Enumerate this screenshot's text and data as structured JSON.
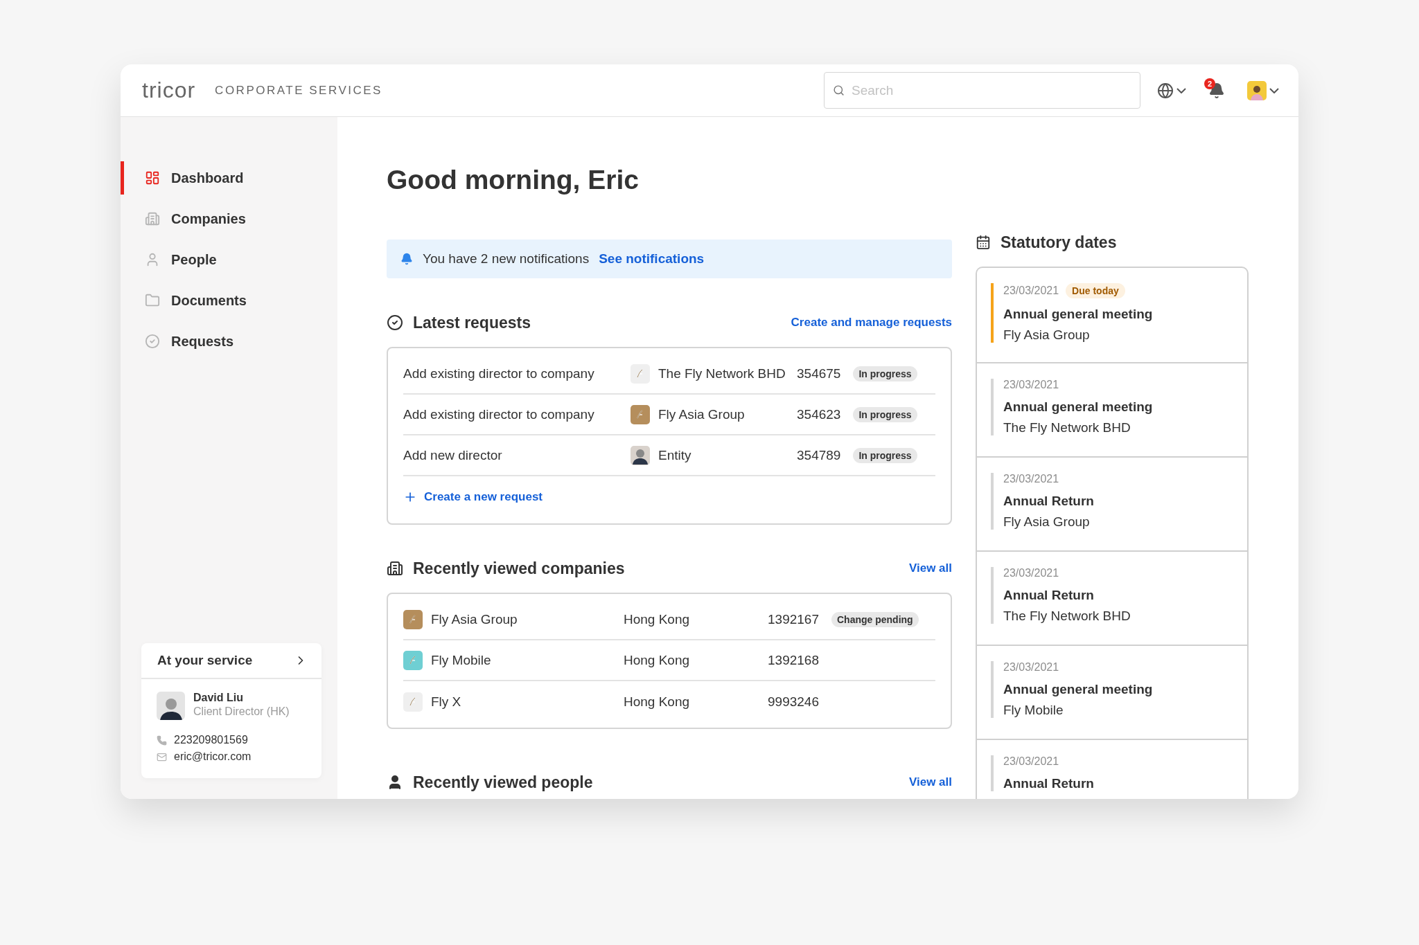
{
  "header": {
    "logo": "tricor",
    "product": "CORPORATE SERVICES",
    "search": {
      "placeholder": "Search"
    },
    "notification_count": "2"
  },
  "sidebar": {
    "items": [
      {
        "label": "Dashboard",
        "selected": true
      },
      {
        "label": "Companies",
        "selected": false
      },
      {
        "label": "People",
        "selected": false
      },
      {
        "label": "Documents",
        "selected": false
      },
      {
        "label": "Requests",
        "selected": false
      }
    ],
    "service_card": {
      "title": "At your service",
      "name": "David Liu",
      "role": "Client Director (HK)",
      "phone": "223209801569",
      "email": "eric@tricor.com"
    }
  },
  "greeting": "Good morning, Eric",
  "notice": {
    "text": "You have 2 new notifications",
    "link": "See notifications"
  },
  "latest_requests": {
    "title": "Latest requests",
    "link": "Create and manage requests",
    "rows": [
      {
        "request": "Add existing director to company",
        "entity": "The Fly Network BHD",
        "kind": "logo",
        "color": "#efefef",
        "number": "354675",
        "status": "In progress"
      },
      {
        "request": "Add existing director to company",
        "entity": "Fly Asia Group",
        "kind": "logo",
        "color": "#b58e5c",
        "number": "354623",
        "status": "In progress"
      },
      {
        "request": "Add new director",
        "entity": "Entity",
        "kind": "person",
        "color": "#d9d2cc",
        "number": "354789",
        "status": "In progress"
      }
    ],
    "create": "Create a new request"
  },
  "recent_companies": {
    "title": "Recently viewed companies",
    "link": "View all",
    "rows": [
      {
        "name": "Fly Asia Group",
        "color": "#b58e5c",
        "location": "Hong Kong",
        "number": "1392167",
        "status": "Change pending"
      },
      {
        "name": "Fly Mobile",
        "color": "#6fcfd3",
        "location": "Hong Kong",
        "number": "1392168"
      },
      {
        "name": "Fly X",
        "color": "#efefef",
        "location": "Hong Kong",
        "number": "9993246"
      }
    ]
  },
  "recent_people": {
    "title": "Recently viewed people",
    "link": "View all"
  },
  "statutory": {
    "title": "Statutory dates",
    "items": [
      {
        "date": "23/03/2021",
        "badge": "Due today",
        "urgent": true,
        "event": "Annual general meeting",
        "company": "Fly Asia Group"
      },
      {
        "date": "23/03/2021",
        "urgent": false,
        "event": "Annual general meeting",
        "company": "The Fly Network BHD"
      },
      {
        "date": "23/03/2021",
        "urgent": false,
        "event": "Annual Return",
        "company": "Fly Asia Group"
      },
      {
        "date": "23/03/2021",
        "urgent": false,
        "event": "Annual Return",
        "company": "The Fly Network BHD"
      },
      {
        "date": "23/03/2021",
        "urgent": false,
        "event": "Annual general meeting",
        "company": "Fly Mobile"
      },
      {
        "date": "23/03/2021",
        "urgent": false,
        "event": "Annual Return"
      }
    ]
  }
}
